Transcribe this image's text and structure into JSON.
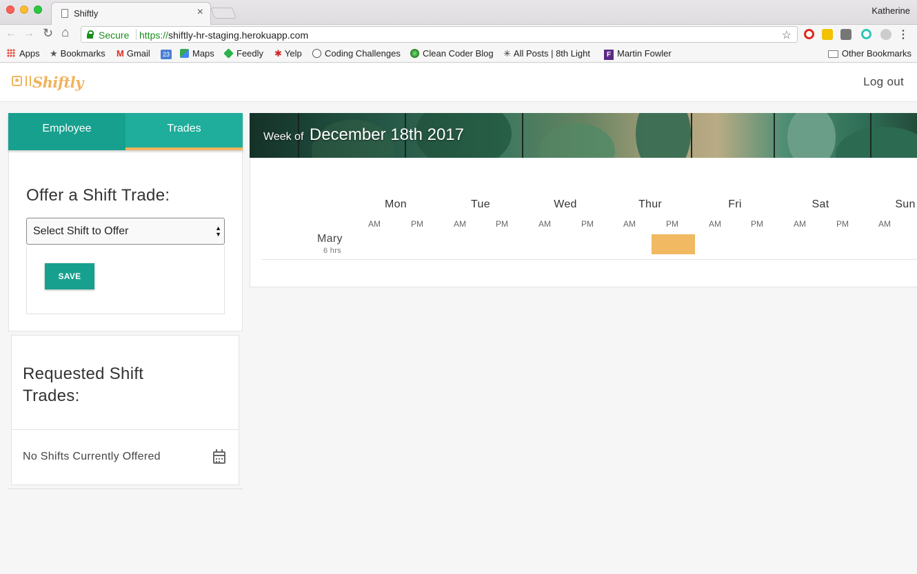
{
  "browser": {
    "tab_title": "Shiftly",
    "tab_close": "×",
    "profile_name": "Katherine",
    "secure_label": "Secure",
    "url_scheme": "https://",
    "url_host": "shiftly-hr-staging.herokuapp.com",
    "back_glyph": "←",
    "forward_glyph": "→",
    "reload_glyph": "↻",
    "home_glyph": "⌂",
    "star_glyph": "☆",
    "menu_glyph": "⋮",
    "bookmarks": [
      {
        "label": "Apps",
        "icon": "apps-grid-icon"
      },
      {
        "label": "Bookmarks",
        "icon": "star-icon"
      },
      {
        "label": "Gmail",
        "icon": "gmail-icon"
      },
      {
        "label": "",
        "icon": "calendar-23-icon"
      },
      {
        "label": "Maps",
        "icon": "maps-icon"
      },
      {
        "label": "Feedly",
        "icon": "feedly-icon"
      },
      {
        "label": "Yelp",
        "icon": "yelp-icon"
      },
      {
        "label": "Coding Challenges",
        "icon": "reddit-icon"
      },
      {
        "label": "Clean Coder Blog",
        "icon": "clean-coder-icon"
      },
      {
        "label": "All Posts | 8th Light",
        "icon": "8th-light-icon"
      },
      {
        "label": "Martin Fowler",
        "icon": "martin-fowler-icon"
      }
    ],
    "other_bookmarks": "Other Bookmarks",
    "calendar_bm_text": "23",
    "gmail_glyph": "M",
    "star_bm_glyph": "★",
    "yelp_glyph": "✱",
    "eighth_glyph": "✳",
    "fowler_glyph": "F"
  },
  "app": {
    "logo_text": "Shiftly",
    "logout_label": "Log out",
    "tabs": [
      {
        "label": "Employee",
        "active": false
      },
      {
        "label": "Trades",
        "active": true
      }
    ],
    "offer_title": "Offer a Shift Trade:",
    "offer_select_value": "Select Shift to Offer",
    "save_label": "SAVE",
    "requested_title": "Requested Shift Trades:",
    "requested_empty": "No Shifts Currently Offered",
    "colors": {
      "primary": "#17a08e",
      "accent": "#f0b35c",
      "shift": "#f0b962"
    }
  },
  "schedule": {
    "week_prefix": "Week of",
    "week_date": "December 18th 2017",
    "days": [
      "Mon",
      "Tue",
      "Wed",
      "Thur",
      "Fri",
      "Sat",
      "Sun"
    ],
    "am_label": "AM",
    "pm_label": "PM",
    "employees": [
      {
        "name": "Mary",
        "hours": "6 hrs",
        "shift_day": "Thur",
        "shift_half": "PM"
      }
    ]
  }
}
